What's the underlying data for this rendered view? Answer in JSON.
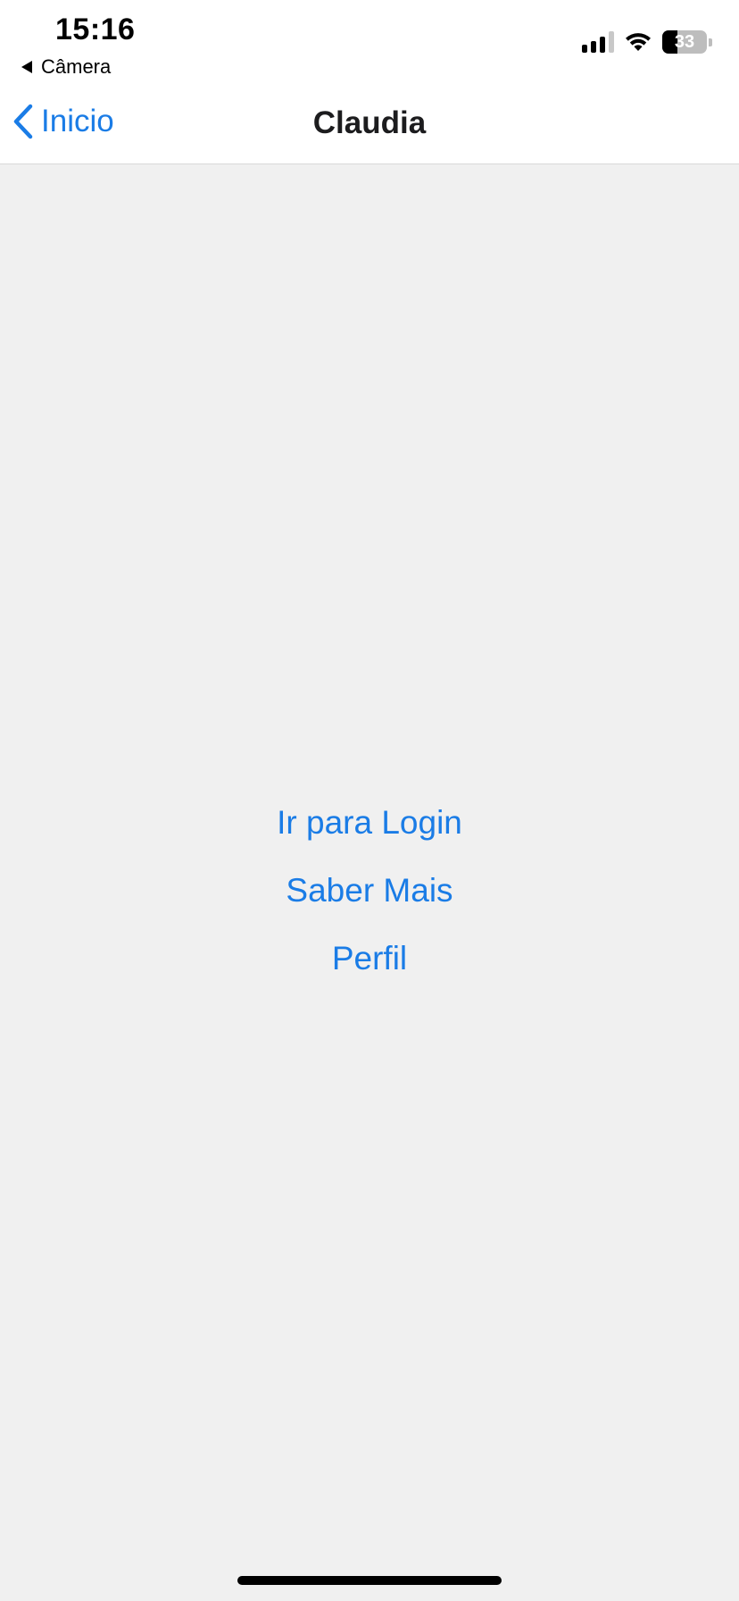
{
  "status_bar": {
    "time": "15:16",
    "back_app_label": "Câmera",
    "battery_percent": "33",
    "battery_level": 0.33
  },
  "nav": {
    "back_label": "Inicio",
    "title": "Claudia"
  },
  "menu": {
    "items": [
      {
        "label": "Ir para Login"
      },
      {
        "label": "Saber Mais"
      },
      {
        "label": "Perfil"
      }
    ]
  },
  "colors": {
    "accent": "#1a7ce6",
    "background": "#f0f0f0",
    "header_background": "#ffffff"
  }
}
